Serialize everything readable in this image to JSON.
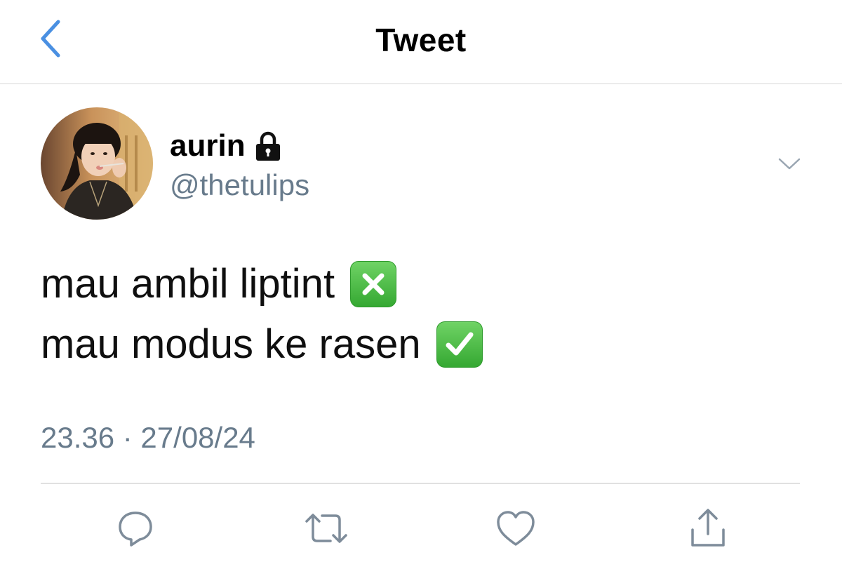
{
  "header": {
    "title": "Tweet",
    "back_icon": "chevron-left-icon",
    "accent_color": "#4a90e2"
  },
  "author": {
    "display_name": "aurin",
    "handle": "@thetulips",
    "protected_icon": "lock-icon"
  },
  "tweet": {
    "lines": [
      {
        "text": "mau ambil liptint",
        "emoji": "cross-mark-button-emoji"
      },
      {
        "text": "mau modus ke rasen",
        "emoji": "check-mark-button-emoji"
      }
    ],
    "timestamp": "23.36 · 27/08/24"
  },
  "actions": [
    "reply-icon",
    "retweet-icon",
    "like-icon",
    "share-icon"
  ],
  "colors": {
    "secondary_text": "#687b8c",
    "icon_gray": "#7e8c9a",
    "emoji_green": "#4cbf46"
  }
}
